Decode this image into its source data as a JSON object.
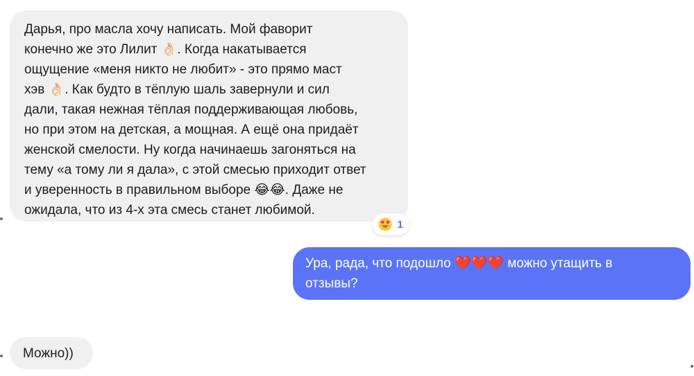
{
  "messages": [
    {
      "direction": "incoming",
      "text": "Дарья, про масла хочу написать. Мой фаворит\nконечно же это Лилит 👌🏻. Когда накатывается\nощущение «меня никто не любит» - это прямо маст\nхэв 👌🏻. Как будто в тёплую шаль завернули и сил\nдали, такая нежная тёплая поддерживающая любовь,\nно при этом на детская, а мощная. А ещё она придаёт\nженской смелости. Ну когда начинаешь загоняться на\nтему «а тому ли я дала», с этой смесью приходит ответ\nи уверенность в правильном выборе 😂😂. Даже не\nожидала, что из 4-х эта смесь станет любимой.",
      "reaction": {
        "icon": "heart-eyes-emoji",
        "count": "1"
      }
    },
    {
      "direction": "outgoing",
      "text": "Ура, рада, что подошло ❤️❤️❤️ можно утащить в\nотзывы?"
    },
    {
      "direction": "incoming",
      "text": "Можно))"
    }
  ],
  "colors": {
    "incoming_bubble": "#f0f0f0",
    "outgoing_bubble": "#5a73f7",
    "reaction_count": "#7a5af0"
  }
}
